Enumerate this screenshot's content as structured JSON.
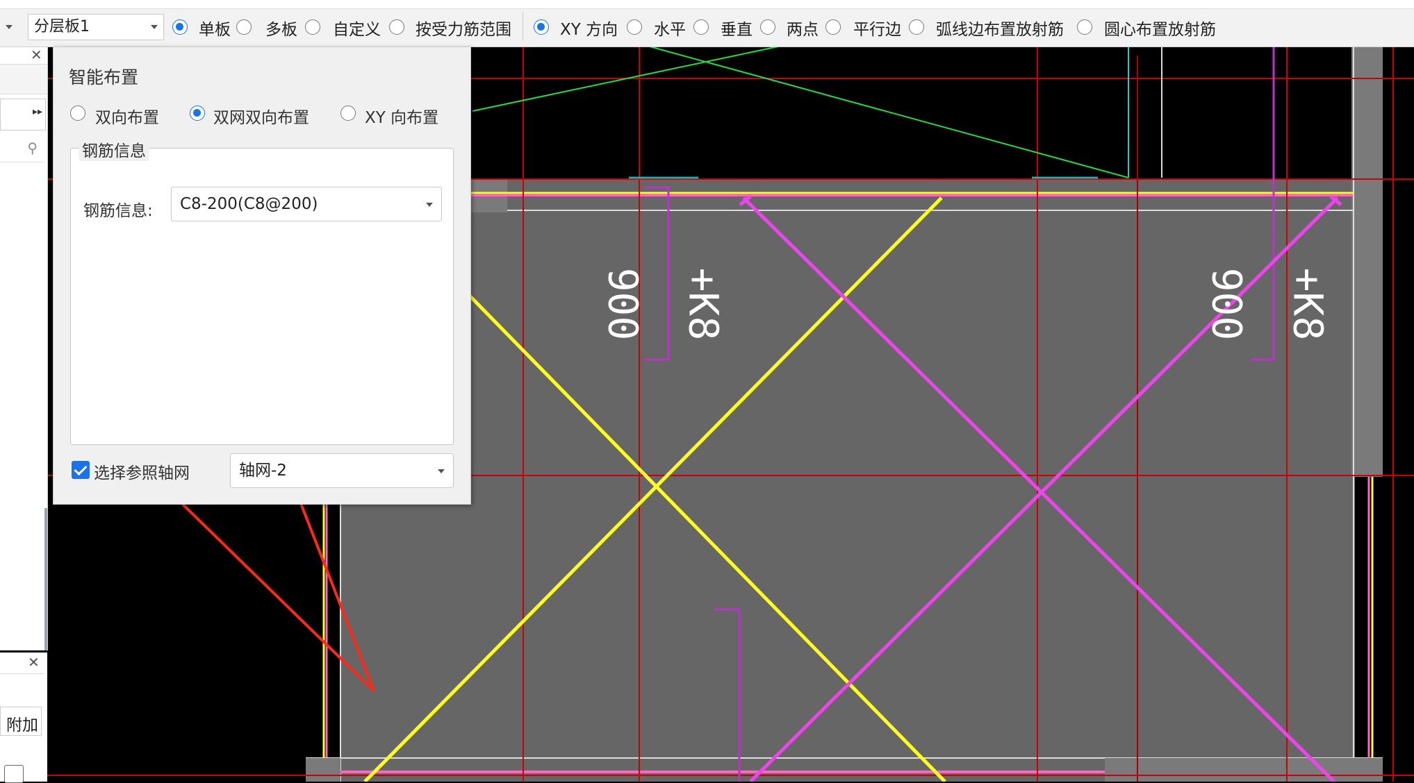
{
  "toolbar": {
    "layer_combo": "分层板1",
    "mode_options": [
      "单板",
      "多板",
      "自定义",
      "按受力筋范围"
    ],
    "mode_selected": 0,
    "direction_options": [
      "XY 方向",
      "水平",
      "垂直",
      "两点",
      "平行边",
      "弧线边布置放射筋",
      "圆心布置放射筋"
    ],
    "direction_selected": 0
  },
  "dialog": {
    "title": "智能布置",
    "layout_options": [
      "双向布置",
      "双网双向布置",
      "XY 向布置"
    ],
    "layout_selected": 1,
    "group_title": "钢筋信息",
    "rebar_label": "钢筋信息:",
    "rebar_value": "C8-200(C8@200)",
    "axis_checkbox_label": "选择参照轴网",
    "axis_checked": true,
    "axis_value": "轴网-2"
  },
  "left_bottom": {
    "label": "附加"
  },
  "canvas_labels": {
    "dim_a": "900",
    "mark_a": "+K8",
    "dim_b": "900",
    "mark_b": "+K8"
  },
  "colors": {
    "background": "#000000",
    "slab": "#666666",
    "yellow_rebar": "#ffff22",
    "magenta_rebar": "#ee44ee",
    "axis": "#cc0000",
    "arrow": "#ff2a1a",
    "accent": "#1a73e8"
  }
}
